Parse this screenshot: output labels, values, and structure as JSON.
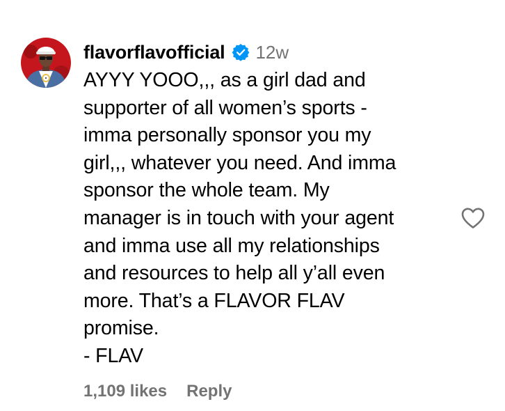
{
  "comment": {
    "username": "flavorflavofficial",
    "verified_icon": "verified-badge-icon",
    "timestamp": "12w",
    "text": "AYYY YOOO,,, as a girl dad and\nsupporter of all women’s sports -\nimma personally sponsor you my\ngirl,,, whatever you need. And imma\nsponsor the whole team. My\nmanager is in touch with your agent\nand imma use all my relationships\nand resources to help all y’all even\nmore. That’s a FLAVOR FLAV\npromise.\n- FLAV",
    "likes": "1,109 likes",
    "reply_label": "Reply",
    "like_icon": "heart-outline-icon"
  },
  "colors": {
    "verified_blue": "#0095F6",
    "secondary_text": "#737373",
    "avatar_bg": "#C4161C"
  }
}
